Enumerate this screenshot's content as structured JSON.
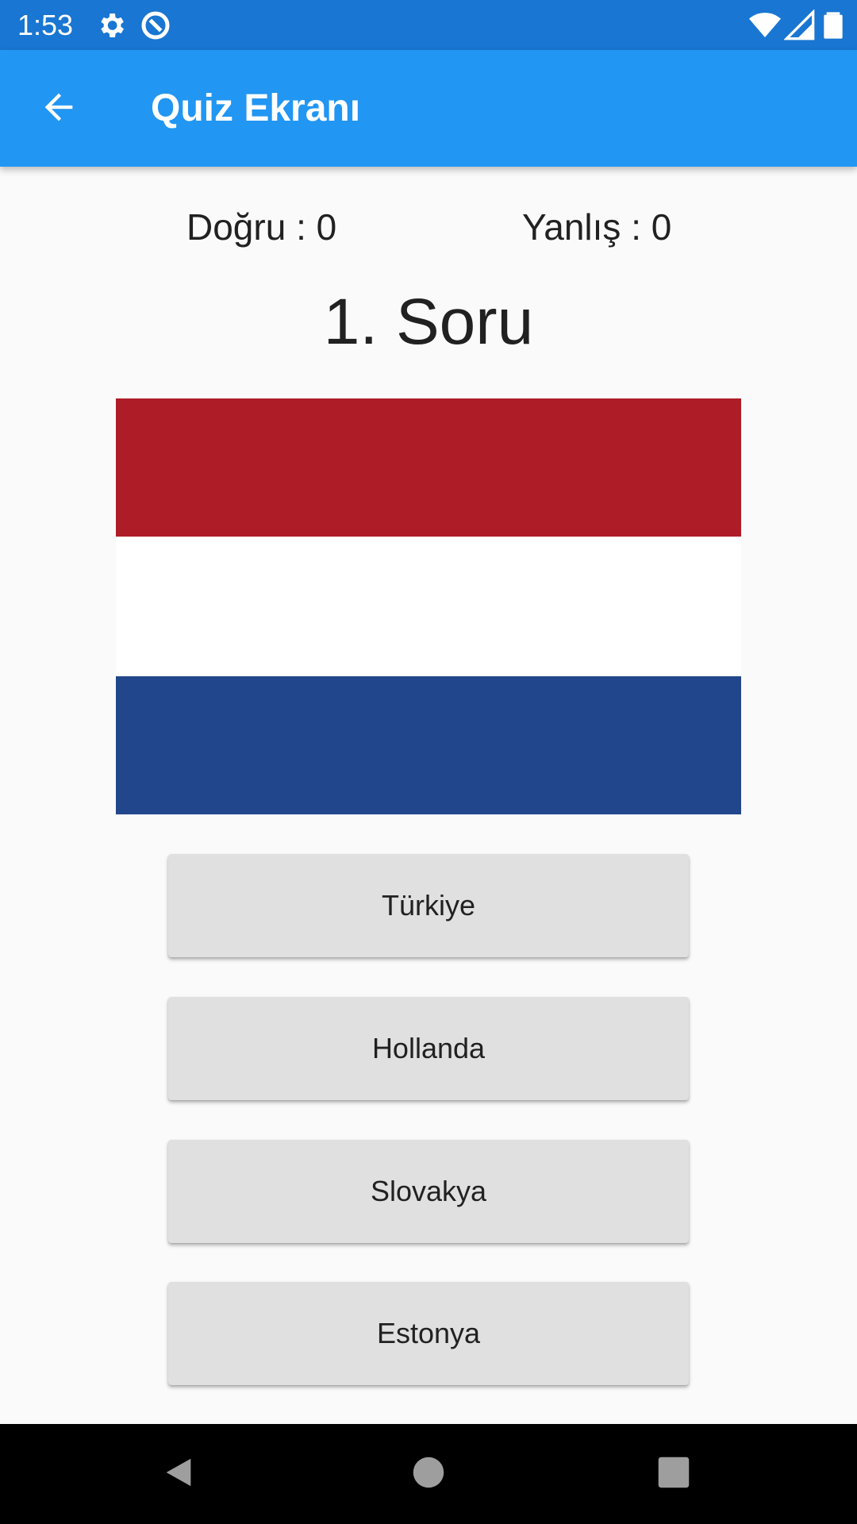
{
  "status_bar": {
    "time": "1:53",
    "icons": [
      "settings-icon",
      "sync-icon",
      "wifi-icon",
      "signal-icon",
      "battery-icon"
    ],
    "background": "#1976d2"
  },
  "app_bar": {
    "title": "Quiz Ekranı",
    "back_icon": "arrow-back-icon",
    "background": "#2196f3"
  },
  "score": {
    "correct": "Doğru : 0",
    "wrong": "Yanlış : 0"
  },
  "question": {
    "title": "1. Soru"
  },
  "flag": {
    "stripes": [
      "#ae1c28",
      "#ffffff",
      "#21468b"
    ]
  },
  "answers": [
    {
      "label": "Türkiye"
    },
    {
      "label": "Hollanda"
    },
    {
      "label": "Slovakya"
    },
    {
      "label": "Estonya"
    }
  ],
  "nav_bar": {
    "icons": [
      "back-triangle-icon",
      "home-circle-icon",
      "recents-square-icon"
    ]
  }
}
